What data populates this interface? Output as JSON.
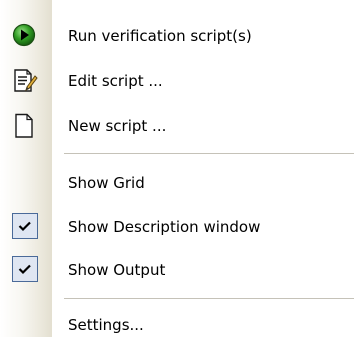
{
  "menu": {
    "items": [
      {
        "label": "Run verification script(s)",
        "icon": "run-green-icon"
      },
      {
        "label": "Edit script ...",
        "icon": "edit-document-icon"
      },
      {
        "label": "New script ...",
        "icon": "new-document-icon"
      },
      {
        "label": "Show Grid",
        "checked": false
      },
      {
        "label": "Show Description window",
        "checked": true
      },
      {
        "label": "Show Output",
        "checked": true
      },
      {
        "label": "Settings..."
      }
    ]
  },
  "colors": {
    "run_icon": "#2a9a1e",
    "check_border": "#4a6a99",
    "check_fill": "#dfe6f2",
    "gutter": "#e3dfd0",
    "separator": "#c5c2b8"
  }
}
